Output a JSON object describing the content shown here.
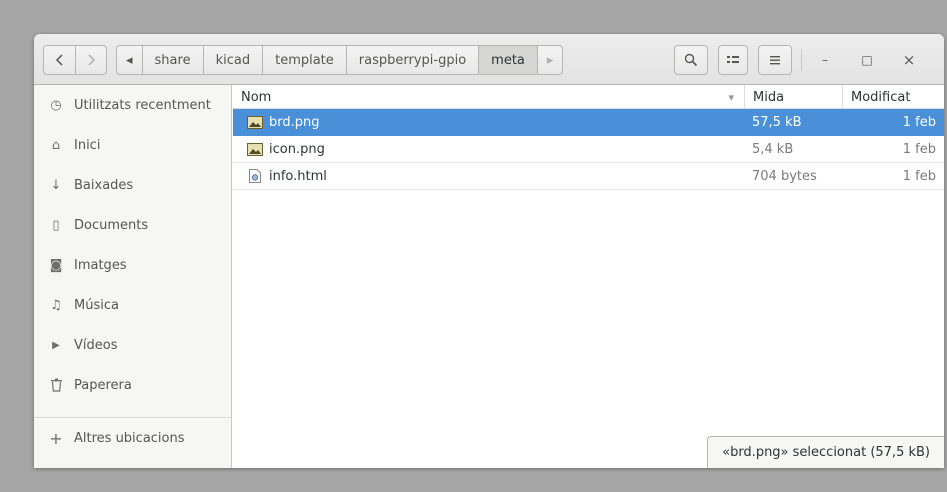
{
  "window": {
    "title": "meta"
  },
  "nav": {
    "back_icon": "chevron-left-icon",
    "forward_icon": "chevron-right-icon"
  },
  "path": {
    "left_arrow": "◂",
    "segments": [
      "share",
      "kicad",
      "template",
      "raspberrypi-gpio",
      "meta"
    ],
    "right_arrow": "▸"
  },
  "toolbar": {
    "search_icon": "search-icon",
    "view_icon": "view-toggle-icon",
    "menu_icon": "menu-icon",
    "minimize": "–",
    "maximize": "□",
    "close": "×"
  },
  "sidebar": {
    "items": [
      {
        "label": "Utilitzats recentment",
        "icon": "clock-icon",
        "glyph": "◷"
      },
      {
        "label": "Inici",
        "icon": "home-icon",
        "glyph": "⌂"
      },
      {
        "label": "Baixades",
        "icon": "download-icon",
        "glyph": "↓"
      },
      {
        "label": "Documents",
        "icon": "document-icon",
        "glyph": "▯"
      },
      {
        "label": "Imatges",
        "icon": "camera-icon",
        "glyph": "◙"
      },
      {
        "label": "Música",
        "icon": "music-icon",
        "glyph": "♫"
      },
      {
        "label": "Vídeos",
        "icon": "video-icon",
        "glyph": "▶"
      },
      {
        "label": "Paperera",
        "icon": "trash-icon",
        "glyph": "🗑"
      },
      {
        "label": "Altres ubicacions",
        "icon": "plus-icon",
        "glyph": "+"
      }
    ]
  },
  "list": {
    "columns": {
      "name": "Nom",
      "size": "Mida",
      "modified": "Modificat"
    },
    "sort_indicator": "▾",
    "rows": [
      {
        "name": "brd.png",
        "size": "57,5 kB",
        "modified": "1 feb",
        "icon": "image-file-icon",
        "selected": true
      },
      {
        "name": "icon.png",
        "size": "5,4 kB",
        "modified": "1 feb",
        "icon": "image-file-icon",
        "selected": false
      },
      {
        "name": "info.html",
        "size": "704 bytes",
        "modified": "1 feb",
        "icon": "html-file-icon",
        "selected": false
      }
    ]
  },
  "status": {
    "text": "«brd.png» seleccionat (57,5 kB)"
  },
  "colors": {
    "selection": "#4a90d9",
    "background": "#a6a6a6",
    "sidebar": "#f6f6f5"
  }
}
